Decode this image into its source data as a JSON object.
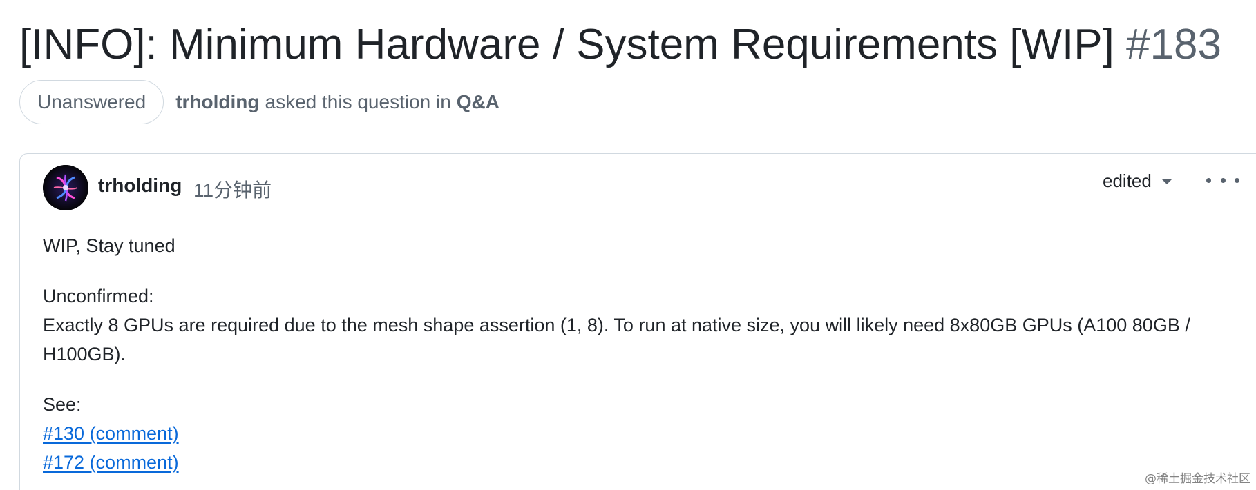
{
  "discussion": {
    "title": "[INFO]: Minimum Hardware / System Requirements [WIP]",
    "number": "#183",
    "status": "Unanswered",
    "asker": "trholding",
    "asked_text": "asked this question in",
    "category": "Q&A"
  },
  "post": {
    "author": "trholding",
    "timestamp": "11分钟前",
    "edited_label": "edited",
    "intro": "WIP, Stay tuned",
    "unconfirmed_label": "Unconfirmed:",
    "unconfirmed_text": "Exactly 8 GPUs are required due to the mesh shape assertion (1, 8). To run at native size, you will likely need 8x80GB GPUs (A100 80GB / H100GB).",
    "see_label": "See:",
    "links": [
      "#130 (comment)",
      "#172 (comment)"
    ]
  },
  "watermark": {
    "site": "@稀土掘金技术社区"
  },
  "colors": {
    "link": "#0969da",
    "muted": "#59636e",
    "text": "#1f2328",
    "border": "#d1d9e0"
  },
  "icons": {
    "caret": "chevron-down-icon",
    "menu": "kebab-horizontal-icon"
  }
}
